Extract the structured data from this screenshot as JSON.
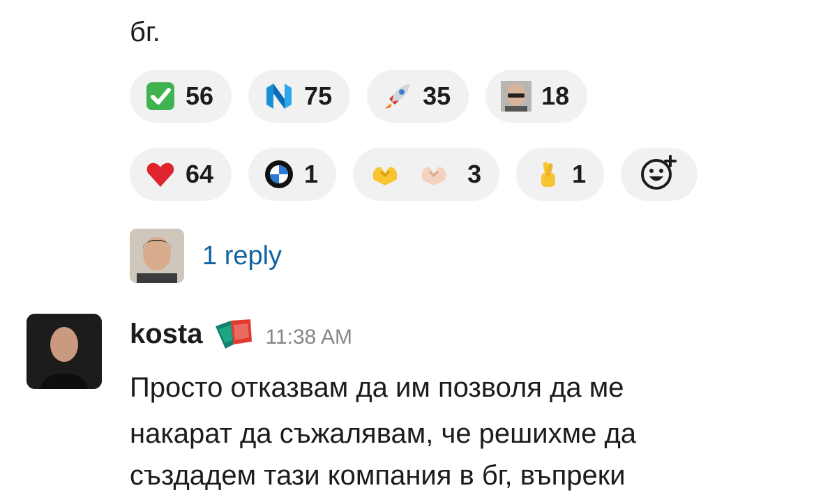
{
  "message_prev": {
    "text_tail": "бг."
  },
  "reactions": [
    {
      "emoji": "check-mark-icon",
      "count": "56"
    },
    {
      "emoji": "n-logo-icon",
      "count": "75"
    },
    {
      "emoji": "rocket-icon",
      "count": "35"
    },
    {
      "emoji": "custom-face-icon",
      "count": "18"
    },
    {
      "emoji": "heart-icon",
      "count": "64"
    },
    {
      "emoji": "bmw-logo-icon",
      "count": "1"
    },
    {
      "emoji": "heart-hands-icon",
      "count": "3"
    },
    {
      "emoji": "crossed-fingers-icon",
      "count": "1"
    }
  ],
  "thread": {
    "reply_label": "1 reply"
  },
  "message": {
    "username": "kosta",
    "timestamp": "11:38 AM",
    "lines": [
      "Просто отказвам да им позволя да ме",
      "накарат да съжалявам, че решихме да",
      "създадем тази компания в бг, въпреки"
    ]
  },
  "colors": {
    "link": "#1264a3",
    "pill_bg": "#f1f1f1",
    "text": "#1d1c1d",
    "muted": "#868686"
  }
}
